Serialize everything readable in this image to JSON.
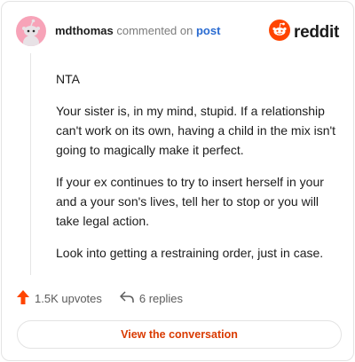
{
  "header": {
    "username": "mdthomas",
    "action_text": "commented on",
    "post_link": "post",
    "brand_name": "reddit",
    "avatar_icon": "snoo-avatar-icon",
    "brand_icon": "reddit-logo-icon"
  },
  "comment": {
    "paragraphs": [
      "NTA",
      "Your sister is, in my mind, stupid. If a relationship can't work on its own, having a child in the mix isn't going to magically make it perfect.",
      "If your ex continues to try to insert herself in your and a your son's lives, tell her to stop or you will take legal action.",
      "Look into getting a restraining order, just in case."
    ]
  },
  "footer": {
    "upvotes": "1.5K upvotes",
    "replies": "6 replies",
    "cta_label": "View the conversation"
  },
  "colors": {
    "accent": "#d93a00",
    "reddit_orange": "#ff4500",
    "link_blue": "#2a6bd1",
    "avatar_pink": "#f7a3b8"
  }
}
